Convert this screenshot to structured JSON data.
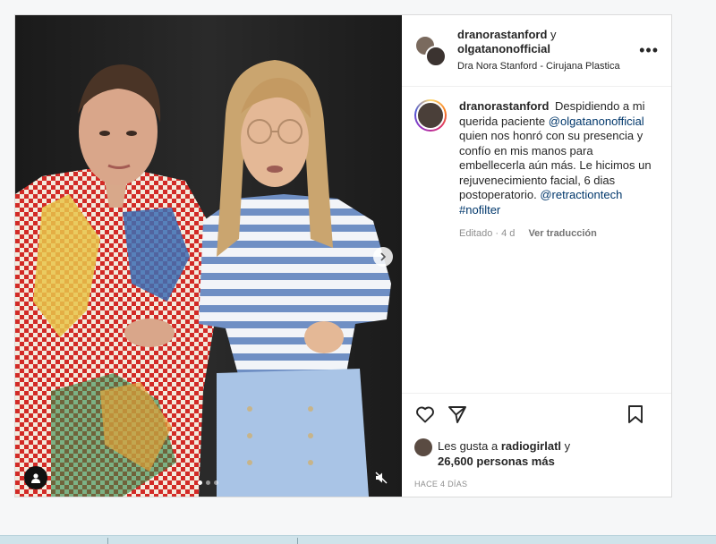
{
  "header": {
    "user1": "dranorastanford",
    "connector": "y",
    "user2": "olgatanonofficial",
    "subtitle": "Dra Nora Stanford - Cirujana Plastica",
    "more_icon": "more-horizontal-icon"
  },
  "caption": {
    "owner": "dranorastanford",
    "text_1": "Despidiendo a mi querida paciente",
    "mention_1": "@olgatanonofficial",
    "text_2": "quien nos honró con su presencia y confío en mis manos para embellecerla aún más. Le hicimos un rejuvenecimiento facial, 6 dias postoperatorio.",
    "mention_2": "@retractiontech",
    "hashtag": "#nofilter",
    "edited": "Editado · 4 d",
    "translate": "Ver traducción"
  },
  "actions": {
    "like_icon": "heart-icon",
    "share_icon": "paper-plane-icon",
    "save_icon": "bookmark-icon"
  },
  "likes": {
    "prefix": "Les gusta a",
    "user": "radiogirlatl",
    "connector": "y",
    "others": "26,600 personas más"
  },
  "posted": "HACE 4 DÍAS",
  "media": {
    "carousel_count": 3,
    "active_index": 0,
    "next_icon": "chevron-right-icon",
    "tag_icon": "user-tag-icon",
    "mute_icon": "speaker-muted-icon"
  },
  "colors": {
    "link": "#00376b",
    "secondary": "#8e8e8e",
    "border": "#dbdbdb",
    "shirt_stripe": "#6f8fc4",
    "pants": "#a9c4e6"
  }
}
